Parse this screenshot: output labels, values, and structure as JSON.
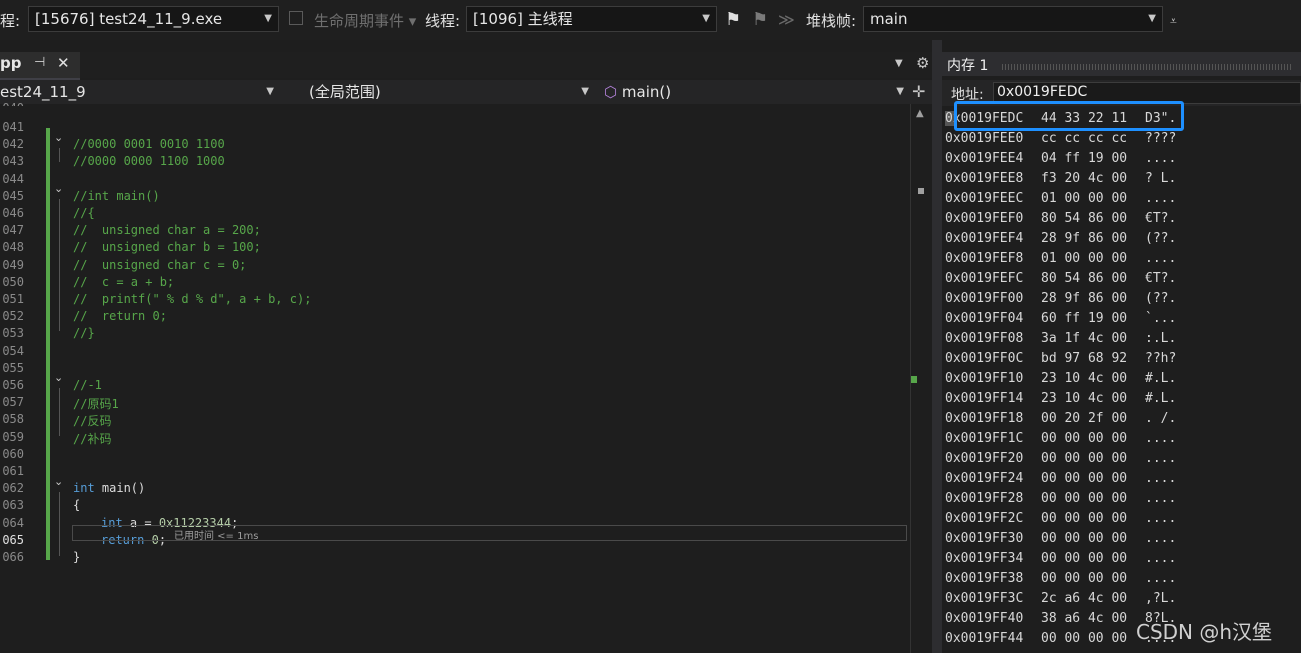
{
  "toolbar": {
    "process_label": "程:",
    "process_value": "[15676] test24_11_9.exe",
    "lifecycle_label": "生命周期事件",
    "thread_label": "线程:",
    "thread_value": "[1096] 主线程",
    "stack_label": "堆栈帧:",
    "stack_value": "main"
  },
  "editor_tab": {
    "name": "pp",
    "pin": "⊣",
    "close": "✕"
  },
  "navbar": {
    "project": "est24_11_9",
    "scope": "(全局范围)",
    "function": "main()"
  },
  "code_lines": [
    {
      "n": "041",
      "t": ""
    },
    {
      "n": "042",
      "t": "//0000 0001 0010 1100"
    },
    {
      "n": "043",
      "t": "//0000 0000 1100 1000"
    },
    {
      "n": "044",
      "t": ""
    },
    {
      "n": "045",
      "t": "//int main()"
    },
    {
      "n": "046",
      "t": "//{"
    },
    {
      "n": "047",
      "t": "//  unsigned char a = 200;"
    },
    {
      "n": "048",
      "t": "//  unsigned char b = 100;"
    },
    {
      "n": "049",
      "t": "//  unsigned char c = 0;"
    },
    {
      "n": "050",
      "t": "//  c = a + b;"
    },
    {
      "n": "051",
      "t": "//  printf(\" % d % d\", a + b, c);"
    },
    {
      "n": "052",
      "t": "//  return 0;"
    },
    {
      "n": "053",
      "t": "//}"
    },
    {
      "n": "054",
      "t": ""
    },
    {
      "n": "055",
      "t": ""
    },
    {
      "n": "056",
      "t": "//-1"
    },
    {
      "n": "057",
      "t": "//原码1"
    },
    {
      "n": "058",
      "t": "//反码"
    },
    {
      "n": "059",
      "t": "//补码"
    },
    {
      "n": "060",
      "t": ""
    },
    {
      "n": "061",
      "t": ""
    },
    {
      "n": "062",
      "t": "int main()"
    },
    {
      "n": "063",
      "t": "{"
    },
    {
      "n": "064",
      "t": "int a = 0x11223344;"
    },
    {
      "n": "065",
      "t": "return 0;"
    },
    {
      "n": "066",
      "t": "}"
    }
  ],
  "elapsed_hint": "已用时间 <= 1ms",
  "memory": {
    "tab_title": "内存 1",
    "address_label": "地址:",
    "address_value": "0x0019FEDC",
    "rows": [
      {
        "addr": "0x0019FEDC",
        "bytes": "44 33 22 11",
        "text": "D3\"."
      },
      {
        "addr": "0x0019FEE0",
        "bytes": "cc cc cc cc",
        "text": "????"
      },
      {
        "addr": "0x0019FEE4",
        "bytes": "04 ff 19 00",
        "text": "...."
      },
      {
        "addr": "0x0019FEE8",
        "bytes": "f3 20 4c 00",
        "text": "? L."
      },
      {
        "addr": "0x0019FEEC",
        "bytes": "01 00 00 00",
        "text": "...."
      },
      {
        "addr": "0x0019FEF0",
        "bytes": "80 54 86 00",
        "text": "€T?."
      },
      {
        "addr": "0x0019FEF4",
        "bytes": "28 9f 86 00",
        "text": "(??."
      },
      {
        "addr": "0x0019FEF8",
        "bytes": "01 00 00 00",
        "text": "...."
      },
      {
        "addr": "0x0019FEFC",
        "bytes": "80 54 86 00",
        "text": "€T?."
      },
      {
        "addr": "0x0019FF00",
        "bytes": "28 9f 86 00",
        "text": "(??."
      },
      {
        "addr": "0x0019FF04",
        "bytes": "60 ff 19 00",
        "text": "`..."
      },
      {
        "addr": "0x0019FF08",
        "bytes": "3a 1f 4c 00",
        "text": ":.L."
      },
      {
        "addr": "0x0019FF0C",
        "bytes": "bd 97 68 92",
        "text": "??h?"
      },
      {
        "addr": "0x0019FF10",
        "bytes": "23 10 4c 00",
        "text": "#.L."
      },
      {
        "addr": "0x0019FF14",
        "bytes": "23 10 4c 00",
        "text": "#.L."
      },
      {
        "addr": "0x0019FF18",
        "bytes": "00 20 2f 00",
        "text": ". /."
      },
      {
        "addr": "0x0019FF1C",
        "bytes": "00 00 00 00",
        "text": "...."
      },
      {
        "addr": "0x0019FF20",
        "bytes": "00 00 00 00",
        "text": "...."
      },
      {
        "addr": "0x0019FF24",
        "bytes": "00 00 00 00",
        "text": "...."
      },
      {
        "addr": "0x0019FF28",
        "bytes": "00 00 00 00",
        "text": "...."
      },
      {
        "addr": "0x0019FF2C",
        "bytes": "00 00 00 00",
        "text": "...."
      },
      {
        "addr": "0x0019FF30",
        "bytes": "00 00 00 00",
        "text": "...."
      },
      {
        "addr": "0x0019FF34",
        "bytes": "00 00 00 00",
        "text": "...."
      },
      {
        "addr": "0x0019FF38",
        "bytes": "00 00 00 00",
        "text": "...."
      },
      {
        "addr": "0x0019FF3C",
        "bytes": "2c a6 4c 00",
        "text": ",?L."
      },
      {
        "addr": "0x0019FF40",
        "bytes": "38 a6 4c 00",
        "text": "8?L."
      },
      {
        "addr": "0x0019FF44",
        "bytes": "00 00 00 00",
        "text": "...."
      }
    ]
  },
  "watermark": "CSDN @h汉堡",
  "colors": {
    "highlight_box": "#1e90ff",
    "comment": "#57a64a",
    "keyword": "#569cd6"
  }
}
